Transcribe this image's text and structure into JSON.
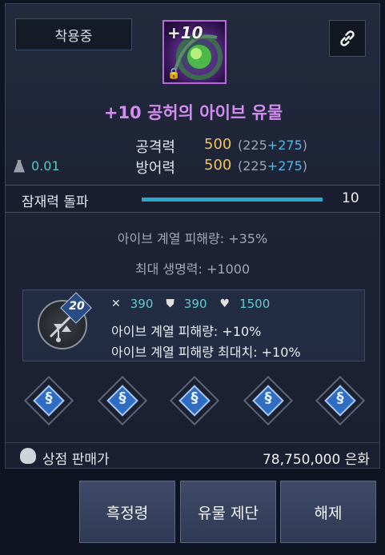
{
  "header": {
    "equipped_label": "착용중",
    "enhance_level": "+10",
    "item_name": "+10 공허의 아이브 유물",
    "icon_names": {
      "item": "relic-orb-icon",
      "lock": "lock-icon",
      "link": "link-icon"
    }
  },
  "stats": {
    "weight": "0.01",
    "attack": {
      "label": "공격력",
      "value": "500",
      "base": "225",
      "bonus": "+275"
    },
    "defense": {
      "label": "방어력",
      "value": "500",
      "base": "225",
      "bonus": "+275"
    }
  },
  "potential": {
    "label": "잠재력 돌파",
    "value": "10",
    "fill_fraction": 1.0
  },
  "effects": [
    "아이브 계열 피해량: +35%",
    "최대 생명력: +1000"
  ],
  "rune": {
    "level": "20",
    "attack": "390",
    "defense": "390",
    "hp": "1500",
    "lines": [
      "아이브 계열 피해량: +10%",
      "아이브 계열 피해량 최대치: +10%"
    ]
  },
  "sockets": [
    "socket-gem",
    "socket-gem",
    "socket-gem",
    "socket-gem",
    "socket-gem"
  ],
  "sell": {
    "label": "상점 판매가",
    "value": "78,750,000 은화"
  },
  "buttons": {
    "essence": "흑정령",
    "dismantle": "유물 제단",
    "unequip": "해제"
  },
  "colors": {
    "item_name": "#d58cf1",
    "stat_value": "#f0c35b",
    "potential_fill": "#2aa9c9",
    "weight": "#59c7c4"
  }
}
